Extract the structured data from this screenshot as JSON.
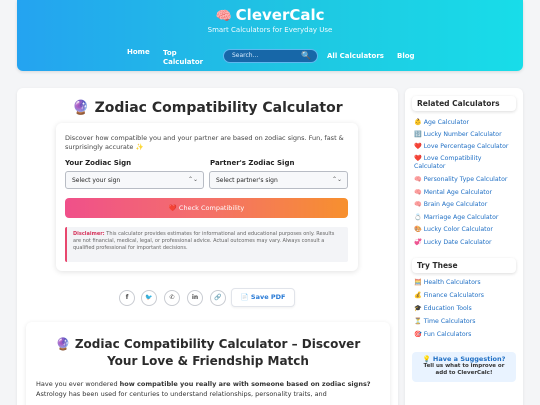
{
  "header": {
    "logo_icon": "🧠",
    "brand": "CleverCalc",
    "tagline": "Smart Calculators for Everyday Use",
    "nav": {
      "home": "Home",
      "top_calculator_line1": "Top",
      "top_calculator_line2": "Calculator",
      "all_calculators": "All Calculators",
      "blog": "Blog"
    },
    "search": {
      "placeholder": "Search...",
      "icon": "🔍"
    }
  },
  "main": {
    "title": "🔮 Zodiac Compatibility Calculator",
    "intro": "Discover how compatible you and your partner are based on zodiac signs. Fun, fast & surprisingly accurate ✨",
    "your_sign_label": "Your Zodiac Sign",
    "partner_sign_label": "Partner's Zodiac Sign",
    "your_sign_value": "Select your sign",
    "partner_sign_value": "Select partner's sign",
    "check_button": "❤️ Check Compatibility",
    "disclaimer_label": "Disclaimer:",
    "disclaimer_text": " This calculator provides estimates for informational and educational purposes only. Results are not financial, medical, legal, or professional advice. Actual outcomes may vary. Always consult a qualified professional for important decisions.",
    "share": {
      "facebook": "f",
      "twitter": "🐦",
      "whatsapp": "✆",
      "linkedin": "in",
      "copy_link": "🔗"
    },
    "save_pdf": "📄 Save PDF"
  },
  "article": {
    "title": "🔮 Zodiac Compatibility Calculator – Discover Your Love & Friendship Match",
    "body_start": "Have you ever wondered ",
    "body_bold": "how compatible you really are with someone based on zodiac signs?",
    "body_rest": " Astrology has been used for centuries to understand relationships, personality traits, and"
  },
  "sidebar": {
    "related_heading": "Related Calculators",
    "related": [
      {
        "icon": "👶",
        "label": "Age Calculator"
      },
      {
        "icon": "🔢",
        "label": "Lucky Number Calculator"
      },
      {
        "icon": "❤️",
        "label": "Love Percentage Calculator"
      },
      {
        "icon": "❤️",
        "label": "Love Compatibility Calculator"
      },
      {
        "icon": "🧠",
        "label": "Personality Type Calculator"
      },
      {
        "icon": "🧠",
        "label": "Mental Age Calculator"
      },
      {
        "icon": "🧠",
        "label": "Brain Age Calculator"
      },
      {
        "icon": "💍",
        "label": "Marriage Age Calculator"
      },
      {
        "icon": "🎨",
        "label": "Lucky Color Calculator"
      },
      {
        "icon": "💞",
        "label": "Lucky Date Calculator"
      }
    ],
    "try_heading": "Try These",
    "try": [
      {
        "icon": "🧮",
        "label": "Health Calculators"
      },
      {
        "icon": "💰",
        "label": "Finance Calculators"
      },
      {
        "icon": "🎓",
        "label": "Education Tools"
      },
      {
        "icon": "⏳",
        "label": "Time Calculators"
      },
      {
        "icon": "🎯",
        "label": "Fun Calculators"
      }
    ],
    "suggestion": {
      "title": "💡 Have a Suggestion?",
      "line1": "Tell us what to improve or",
      "line2": "add to CleverCalc!"
    }
  },
  "colors": {
    "header_gradient_start": "#24a3f0",
    "header_gradient_end": "#18dde9",
    "button_gradient_start": "#f0508a",
    "button_gradient_end": "#f7902e",
    "link": "#1f6fc4",
    "disclaimer_accent": "#d6345c"
  }
}
